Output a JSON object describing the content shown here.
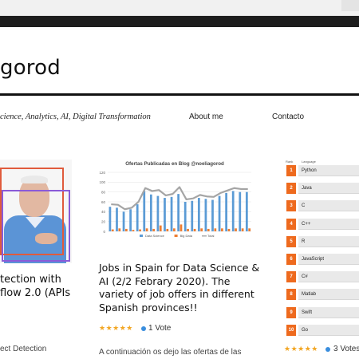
{
  "header": {
    "site_title": "gorod",
    "tagline": "cience, Analytics, AI, Digital Transformation",
    "nav": [
      "About me",
      "Contacto"
    ]
  },
  "posts": [
    {
      "title_lines": [
        "tection with",
        "flow 2.0 (APIs"
      ],
      "meta": "ect Detection"
    },
    {
      "title": "Jobs in Spain for Data Science & AI (2/2 Febrary 2020). The variety of job offers in different Spanish provinces!!",
      "stars": "★★★★★",
      "votes": "1 Vote",
      "excerpt": "A continuación os dejo las ofertas de las"
    },
    {
      "stars": "★★★★★",
      "votes": "3 Votes",
      "ranking": {
        "header_rank": "Rank",
        "header_lang": "Language",
        "rows": [
          {
            "rank": "1",
            "language": "Python"
          },
          {
            "rank": "2",
            "language": "Java"
          },
          {
            "rank": "3",
            "language": "C"
          },
          {
            "rank": "4",
            "language": "C++"
          },
          {
            "rank": "5",
            "language": "R"
          },
          {
            "rank": "6",
            "language": "JavaScript"
          },
          {
            "rank": "7",
            "language": "C#"
          },
          {
            "rank": "8",
            "language": "Matlab"
          },
          {
            "rank": "9",
            "language": "Swift"
          },
          {
            "rank": "10",
            "language": "Go"
          }
        ]
      }
    }
  ],
  "colors": {
    "rank_orange": "#ee6a1e",
    "star": "#f2a623",
    "vote_dot": "#3a8ede",
    "bar_blue": "#5b9bd5",
    "bar_orange": "#ed7d31",
    "line_gray": "#a5a5a5"
  },
  "chart_data": {
    "type": "bar",
    "title": "Ofertas Publicadas en Blog @noeliagorod",
    "ylim": [
      0,
      120
    ],
    "yticks": [
      0,
      20,
      40,
      60,
      80,
      100,
      120
    ],
    "grid": true,
    "legend_placement": "bottom",
    "series": [
      {
        "name": "Data Science",
        "kind": "bar",
        "values": [
          50,
          48,
          40,
          45,
          55,
          82,
          75,
          72,
          68,
          70,
          76,
          60,
          62,
          68,
          66,
          64,
          72,
          78,
          82,
          80,
          80
        ]
      },
      {
        "name": "Big Data",
        "kind": "bar",
        "values": [
          4,
          6,
          5,
          3,
          4,
          6,
          5,
          12,
          5,
          6,
          14,
          5,
          5,
          6,
          5,
          6,
          6,
          5,
          6,
          6,
          6
        ]
      },
      {
        "name": "Total",
        "kind": "line",
        "values": [
          55,
          54,
          45,
          48,
          60,
          88,
          82,
          84,
          73,
          76,
          90,
          65,
          67,
          74,
          71,
          70,
          78,
          83,
          88,
          86,
          86
        ]
      }
    ]
  }
}
